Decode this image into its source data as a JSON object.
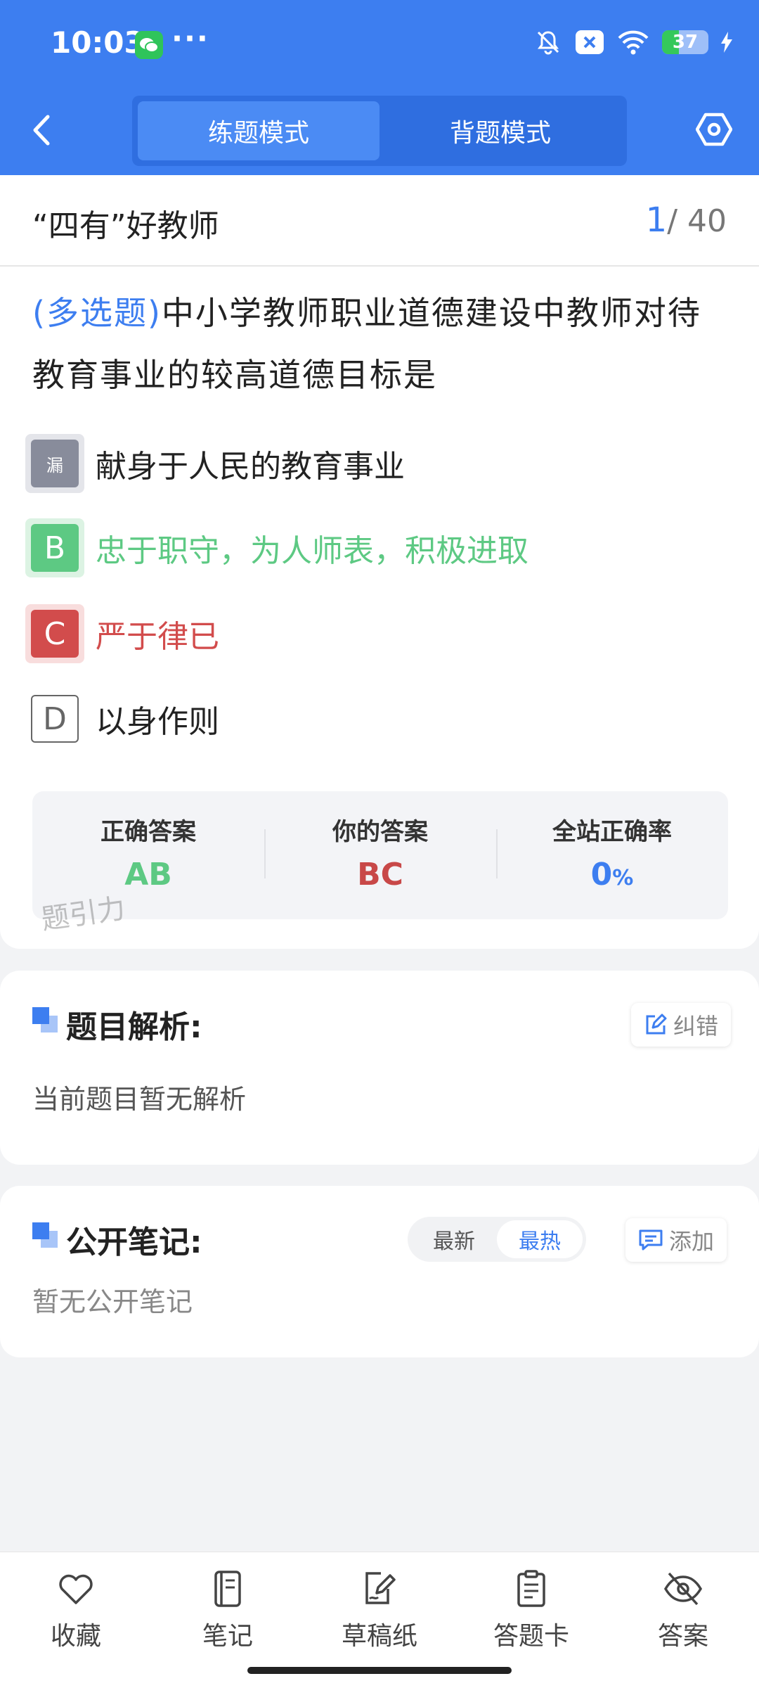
{
  "status": {
    "time": "10:03",
    "dots": "···",
    "battery": "37",
    "battery_level": 0.37
  },
  "header": {
    "tabs": [
      {
        "label": "练题模式",
        "active": true
      },
      {
        "label": "背题模式",
        "active": false
      }
    ]
  },
  "question": {
    "title": "“四有”好教师",
    "current": "1",
    "total": "/ 40",
    "type": "(多选题)",
    "text": "中小学教师职业道德建设中教师对待教育事业的较高道德目标是",
    "options": [
      {
        "letter": "漏",
        "text": "献身于人民的教育事业",
        "state": "missed"
      },
      {
        "letter": "B",
        "text": "忠于职守，为人师表，积极进取",
        "state": "correct"
      },
      {
        "letter": "C",
        "text": "严于律已",
        "state": "wrong"
      },
      {
        "letter": "D",
        "text": "以身作则",
        "state": "normal"
      }
    ]
  },
  "answer_panel": {
    "correct_label": "正确答案",
    "correct_value": "AB",
    "yours_label": "你的答案",
    "yours_value": "BC",
    "rate_label": "全站正确率",
    "rate_value": "0",
    "rate_unit": "%"
  },
  "watermark": "题引力",
  "analysis": {
    "title": "题目解析:",
    "correct_btn": "纠错",
    "text": "当前题目暂无解析"
  },
  "notes": {
    "title": "公开笔记:",
    "seg_latest": "最新",
    "seg_hot": "最热",
    "add_btn": "添加",
    "text": "暂无公开笔记"
  },
  "bottom_nav": [
    {
      "label": "收藏",
      "icon": "heart-icon"
    },
    {
      "label": "笔记",
      "icon": "notebook-icon"
    },
    {
      "label": "草稿纸",
      "icon": "draft-icon"
    },
    {
      "label": "答题卡",
      "icon": "answer-card-icon"
    },
    {
      "label": "答案",
      "icon": "eye-off-icon"
    }
  ],
  "colors": {
    "primary": "#3d7ef0",
    "correct": "#5dc983",
    "wrong": "#d24c4c"
  }
}
